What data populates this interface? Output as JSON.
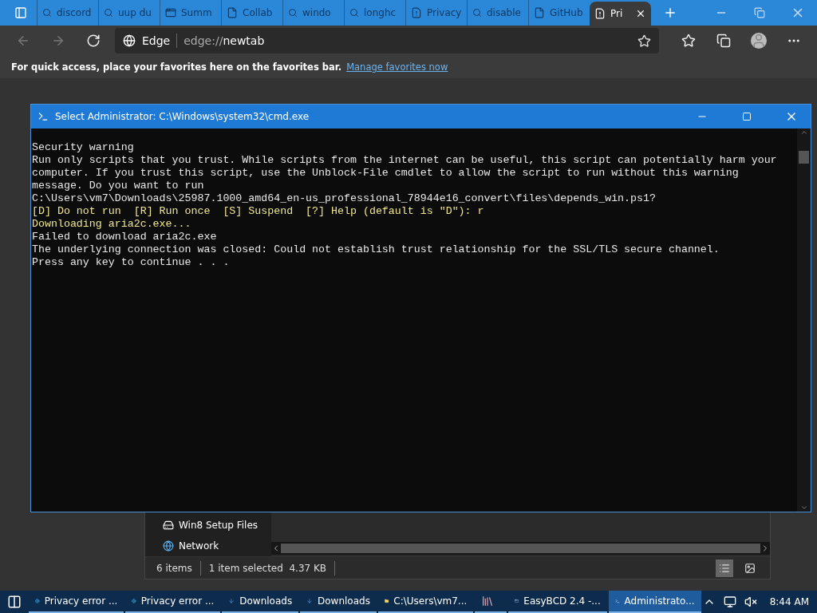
{
  "browser": {
    "tabs": [
      {
        "label": "discord",
        "kind": "search",
        "selected": false
      },
      {
        "label": "uup du",
        "kind": "search",
        "selected": false
      },
      {
        "label": "Summ",
        "kind": "app",
        "selected": false
      },
      {
        "label": "Collab",
        "kind": "doc",
        "selected": false
      },
      {
        "label": "windo",
        "kind": "search",
        "selected": false
      },
      {
        "label": "longhc",
        "kind": "search",
        "selected": false
      },
      {
        "label": "Privacy",
        "kind": "error",
        "selected": false
      },
      {
        "label": "disable",
        "kind": "search",
        "selected": false
      },
      {
        "label": "GitHub",
        "kind": "doc",
        "selected": false
      },
      {
        "label": "Pri",
        "kind": "error",
        "selected": true
      }
    ],
    "site_name": "Edge",
    "address_prefix": "edge://",
    "address_path": "newtab",
    "favorites_hint": "For quick access, place your favorites here on the favorites bar.",
    "favorites_link": "Manage favorites now"
  },
  "console": {
    "title": "Select Administrator: C:\\Windows\\system32\\cmd.exe",
    "lines": [
      {
        "text": "Security warning",
        "color": "#e8e8e8"
      },
      {
        "text": "Run only scripts that you trust. While scripts from the internet can be useful, this script can potentially harm your",
        "color": "#e8e8e8"
      },
      {
        "text": "computer. If you trust this script, use the Unblock-File cmdlet to allow the script to run without this warning",
        "color": "#e8e8e8"
      },
      {
        "text": "message. Do you want to run",
        "color": "#e8e8e8"
      },
      {
        "text": "C:\\Users\\vm7\\Downloads\\25987.1000_amd64_en-us_professional_78944e16_convert\\files\\depends_win.ps1?",
        "color": "#e8e8e8"
      },
      {
        "text": "[D] Do not run  [R] Run once  [S] Suspend  [?] Help (default is \"D\"): r",
        "color": "#f0e68c"
      },
      {
        "text": "Downloading aria2c.exe...",
        "color": "#f0e68c"
      },
      {
        "text": "Failed to download aria2c.exe",
        "color": "#e8e8e8"
      },
      {
        "text": "The underlying connection was closed: Could not establish trust relationship for the SSL/TLS secure channel.",
        "color": "#e8e8e8"
      },
      {
        "text": "Press any key to continue . . .",
        "color": "#e8e8e8"
      }
    ]
  },
  "explorer": {
    "nav_items": [
      {
        "label": "Win8 Setup Files",
        "kind": "drive"
      },
      {
        "label": "Network",
        "kind": "network"
      }
    ],
    "status": {
      "count": "6 items",
      "selection": "1 item selected  4.37 KB"
    },
    "views": [
      {
        "kind": "details",
        "selected": true
      },
      {
        "kind": "tiles",
        "selected": false
      }
    ]
  },
  "taskbar": {
    "items": [
      {
        "label": "Privacy error ...",
        "kind": "edge",
        "selected": false
      },
      {
        "label": "Privacy error ...",
        "kind": "edge",
        "selected": false
      },
      {
        "label": "Downloads",
        "kind": "download",
        "selected": false
      },
      {
        "label": "Downloads",
        "kind": "download",
        "selected": false
      },
      {
        "label": "C:\\Users\\vm7...",
        "kind": "folder",
        "selected": false
      },
      {
        "kind": "books",
        "selected": false
      },
      {
        "label": "EasyBCD 2.4 -...",
        "kind": "app",
        "selected": false
      },
      {
        "label": "Administrato...",
        "kind": "console",
        "selected": true
      }
    ],
    "clock": "8:44 AM"
  }
}
